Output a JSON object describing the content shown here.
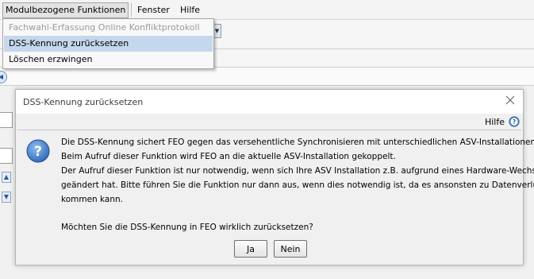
{
  "menubar": {
    "items": [
      {
        "label": "Modulbezogene Funktionen"
      },
      {
        "label": "Fenster"
      },
      {
        "label": "Hilfe"
      }
    ]
  },
  "dropdown": {
    "items": [
      {
        "label": "Fachwahl-Erfassung Online Konfliktprotokoll",
        "state": "disabled"
      },
      {
        "label": "DSS-Kennung zurücksetzen",
        "state": "selected"
      },
      {
        "label": "Löschen erzwingen",
        "state": "enabled"
      }
    ]
  },
  "dialog": {
    "title": "DSS-Kennung zurücksetzen",
    "help_label": "Hilfe",
    "message_lines": [
      "Die DSS-Kennung sichert FEO gegen das versehentliche Synchronisieren mit unterschiedlichen ASV-Installationen ab.",
      "Beim Aufruf dieser Funktion wird FEO an die aktuelle ASV-Installation gekoppelt.",
      "Der Aufruf dieser Funktion ist nur notwendig, wenn sich Ihre ASV Installation z.B. aufgrund eines Hardware-Wechsels",
      "geändert hat. Bitte führen Sie die Funktion nur dann aus, wenn dies notwendig ist, da es ansonsten zu Datenverlusten",
      "kommen kann."
    ],
    "question": "Möchten Sie die DSS-Kennung in FEO wirklich zurücksetzen?",
    "buttons": {
      "yes": "Ja",
      "no": "Nein"
    }
  },
  "icons": {
    "close": "close-icon",
    "help": "help-icon",
    "question": "question-icon"
  },
  "colors": {
    "selected_menu_bg": "#c5d7ec",
    "question_icon_blue": "#3b78c2"
  }
}
